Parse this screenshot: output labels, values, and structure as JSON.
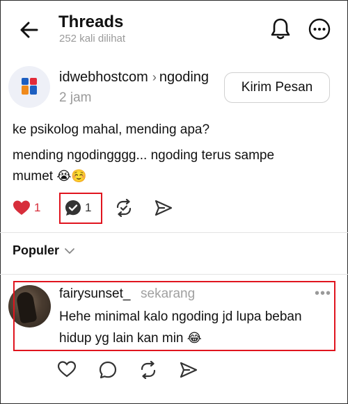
{
  "header": {
    "title": "Threads",
    "views": "252 kali dilihat"
  },
  "post": {
    "author": "idwebhostcom",
    "topic": "ngoding",
    "time": "2 jam",
    "message_button": "Kirim Pesan",
    "line1": "ke psikolog mahal, mending apa?",
    "line2": "mending ngodingggg... ngoding terus sampe",
    "line3": "mumet",
    "line3_emoji": "😭☺️",
    "likes": "1",
    "replies": "1"
  },
  "sort": {
    "label": "Populer"
  },
  "comment": {
    "author": "fairysunset_",
    "time": "sekarang",
    "line1": "Hehe minimal kalo ngoding jd lupa beban",
    "line2": "hidup yg lain kan min",
    "line2_emoji": "😂"
  },
  "colors": {
    "like_red": "#d72e3b",
    "highlight_red": "#e0141e",
    "muted_gray": "#9a9a9a"
  },
  "icons": [
    "back-arrow-icon",
    "bell-icon",
    "more-options-icon",
    "brand-logo-icon",
    "heart-icon",
    "reply-icon",
    "repost-icon",
    "share-icon",
    "chevron-down-icon"
  ]
}
